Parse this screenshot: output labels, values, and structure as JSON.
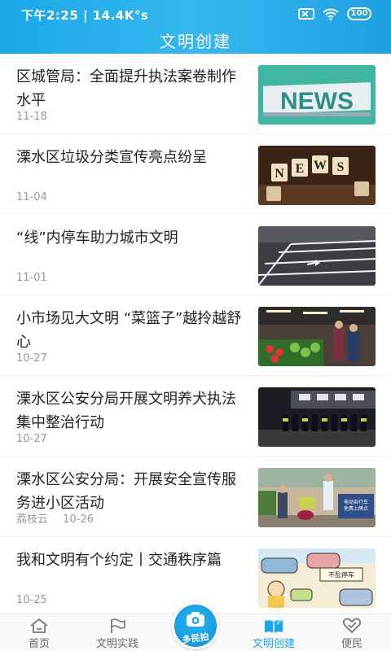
{
  "status_bar": {
    "time_speed": "下午2:25 | 14.4K°s",
    "battery": "100"
  },
  "header": {
    "title": "文明创建"
  },
  "articles": [
    {
      "title": "区城管局：全面提升执法案卷制作水平",
      "source": "",
      "date": "11-18",
      "thumb": "news-sign-image"
    },
    {
      "title": "溧水区垃圾分类宣传亮点纷呈",
      "source": "",
      "date": "11-04",
      "thumb": "news-tiles-image"
    },
    {
      "title": "“线”内停车助力城市文明",
      "source": "",
      "date": "11-01",
      "thumb": "parking-lines-image"
    },
    {
      "title": "小市场见大文明 “菜篮子”越拎越舒心",
      "source": "",
      "date": "10-27",
      "thumb": "market-image"
    },
    {
      "title": "溧水区公安分局开展文明养犬执法集中整治行动",
      "source": "",
      "date": "10-27",
      "thumb": "police-night-image"
    },
    {
      "title": "溧水区公安分局：开展安全宣传服务进小区活动",
      "source": "荔枝云",
      "date": "10-26",
      "thumb": "community-safety-image"
    },
    {
      "title": "我和文明有个约定丨交通秩序篇",
      "source": "",
      "date": "10-25",
      "thumb": "cartoon-traffic-image"
    }
  ],
  "image_text": {
    "community_sign": "电动自行车\n免费上牌点",
    "cartoon_sign": "不乱停车"
  },
  "tabbar": {
    "tabs": [
      {
        "label": "首页",
        "icon": "home-icon"
      },
      {
        "label": "文明实践",
        "icon": "flag-icon"
      },
      {
        "label": "文明创建",
        "icon": "book-icon",
        "active": true
      },
      {
        "label": "便民",
        "icon": "heart-icon"
      }
    ],
    "center": {
      "label": "多民拍",
      "icon": "camera-icon"
    }
  },
  "colors": {
    "accent": "#1aa7e8",
    "meta_text": "#999999"
  }
}
